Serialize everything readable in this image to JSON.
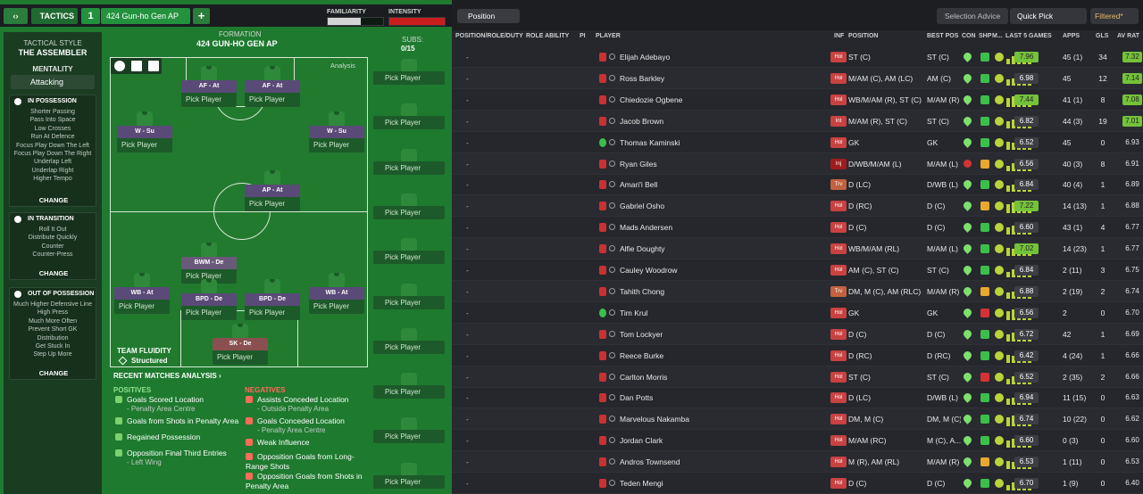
{
  "topbar": {
    "tactics_label": "TACTICS",
    "slot": "1",
    "tactic_name": "424 Gun-ho Gen AP",
    "add": "+",
    "familiarity_label": "FAMILIARITY",
    "intensity_label": "INTENSITY",
    "familiarity_level": 0.6,
    "intensity_level": 1.0
  },
  "sidebar": {
    "title": "TACTICAL STYLE",
    "style": "THE ASSEMBLER",
    "mentality_label": "MENTALITY",
    "mentality": "Attacking",
    "in_possession": {
      "title": "IN POSSESSION",
      "items": [
        "Shorter Passing",
        "Pass Into Space",
        "Low Crosses",
        "Run At Defence",
        "Focus Play Down The Left",
        "Focus Play Down The Right",
        "Underlap Left",
        "Underlap Right",
        "Higher Tempo"
      ],
      "change": "CHANGE"
    },
    "in_transition": {
      "title": "IN TRANSITION",
      "items": [
        "Roll It Out",
        "Distribute Quickly",
        "Counter",
        "Counter-Press"
      ],
      "change": "CHANGE"
    },
    "out_of_possession": {
      "title": "OUT OF POSSESSION",
      "items": [
        "Much Higher Defensive Line",
        "High Press",
        "Much More Often",
        "Prevent Short GK",
        "Distribution",
        "Get Stuck In",
        "Step Up More"
      ],
      "change": "CHANGE"
    }
  },
  "pitch": {
    "formation_label": "FORMATION",
    "formation": "424 GUN-HO GEN AP",
    "subs_label": "SUBS:",
    "subs_value": "0/15",
    "analysis": "Analysis",
    "pick_player": "Pick Player",
    "players": [
      {
        "role": "AF - At"
      },
      {
        "role": "AF - At"
      },
      {
        "role": "W - Su"
      },
      {
        "role": "W - Su"
      },
      {
        "role": "AP - At"
      },
      {
        "role": "BWM - De"
      },
      {
        "role": "WB - At"
      },
      {
        "role": "BPD - De"
      },
      {
        "role": "BPD - De"
      },
      {
        "role": "WB - At"
      },
      {
        "role": "SK - De"
      }
    ],
    "team_fluidity_label": "TEAM FLUIDITY",
    "team_fluidity": "Structured"
  },
  "recent": {
    "title": "RECENT MATCHES ANALYSIS ›",
    "positives_label": "POSITIVES",
    "negatives_label": "NEGATIVES",
    "positives": [
      {
        "text": "Goals Scored Location",
        "sub": "- Penalty Area Centre"
      },
      {
        "text": "Goals from Shots in Penalty Area",
        "sub": ""
      },
      {
        "text": "Regained Possession",
        "sub": ""
      },
      {
        "text": "Opposition Final Third Entries",
        "sub": "- Left Wing"
      }
    ],
    "negatives": [
      {
        "text": "Assists Conceded Location",
        "sub": "- Outside Penalty Area"
      },
      {
        "text": "Goals Conceded Location",
        "sub": "- Penalty Area Centre"
      },
      {
        "text": "Weak Influence",
        "sub": ""
      },
      {
        "text": "Opposition Goals from Long-Range Shots",
        "sub": ""
      },
      {
        "text": "Opposition Goals from Shots in Penalty Area",
        "sub": ""
      }
    ]
  },
  "right": {
    "position_dd": "Position",
    "selection_advice": "Selection Advice",
    "quick_pick": "Quick Pick",
    "filtered": "Filtered*",
    "headers": {
      "prd": "POSITION/ROLE/DUTY",
      "role_ability": "ROLE ABILITY",
      "pi": "PI",
      "player": "PLAYER",
      "inf": "INF",
      "position": "POSITION",
      "best_pos": "BEST POS",
      "con": "CON",
      "shp": "SHP",
      "m": "M...",
      "last5": "LAST 5 GAMES",
      "apps": "APPS",
      "gls": "GLS",
      "av_rat": "AV RAT"
    },
    "rows": [
      {
        "dash": "-",
        "name": "Elijah Adebayo",
        "inf": "Hol",
        "position": "ST (C)",
        "best": "ST (C)",
        "last5": "7.96",
        "last5_hi": true,
        "apps": "45 (1)",
        "gls": "34",
        "avr": "7.32",
        "avr_hi": true,
        "shirt": "outfield",
        "shp": "g",
        "con": "g"
      },
      {
        "dash": "-",
        "name": "Ross Barkley",
        "inf": "Hol",
        "position": "M/AM (C), AM (LC)",
        "best": "AM (C)",
        "last5": "6.98",
        "last5_hi": false,
        "apps": "45",
        "gls": "12",
        "avr": "7.14",
        "avr_hi": true,
        "shirt": "outfield",
        "shp": "g",
        "con": "g"
      },
      {
        "dash": "-",
        "name": "Chiedozie Ogbene",
        "inf": "Hol",
        "position": "WB/M/AM (R), ST (C)",
        "best": "M/AM (R)",
        "last5": "7.44",
        "last5_hi": true,
        "apps": "41 (1)",
        "gls": "8",
        "avr": "7.08",
        "avr_hi": true,
        "shirt": "outfield",
        "shp": "g",
        "con": "g"
      },
      {
        "dash": "-",
        "name": "Jacob Brown",
        "inf": "Int",
        "position": "M/AM (R), ST (C)",
        "best": "ST (C)",
        "last5": "6.82",
        "last5_hi": false,
        "apps": "44 (3)",
        "gls": "19",
        "avr": "7.01",
        "avr_hi": true,
        "shirt": "outfield",
        "shp": "g",
        "con": "g"
      },
      {
        "dash": "-",
        "name": "Thomas Kaminski",
        "inf": "Hol",
        "position": "GK",
        "best": "GK",
        "last5": "6.52",
        "last5_hi": false,
        "apps": "45",
        "gls": "0",
        "avr": "6.93",
        "avr_hi": false,
        "shirt": "gk",
        "shp": "g",
        "con": "g"
      },
      {
        "dash": "-",
        "name": "Ryan Giles",
        "inf": "Inj",
        "position": "D/WB/M/AM (L)",
        "best": "M/AM (L)",
        "last5": "6.56",
        "last5_hi": false,
        "apps": "40 (3)",
        "gls": "8",
        "avr": "6.91",
        "avr_hi": false,
        "shirt": "outfield",
        "shp": "y",
        "con": "r"
      },
      {
        "dash": "-",
        "name": "Amari'i Bell",
        "inf": "Trv",
        "position": "D (LC)",
        "best": "D/WB (L)",
        "last5": "6.84",
        "last5_hi": false,
        "apps": "40 (4)",
        "gls": "1",
        "avr": "6.89",
        "avr_hi": false,
        "shirt": "outfield",
        "shp": "g",
        "con": "g"
      },
      {
        "dash": "-",
        "name": "Gabriel Osho",
        "inf": "Hol",
        "position": "D (RC)",
        "best": "D (C)",
        "last5": "7.22",
        "last5_hi": true,
        "apps": "14 (13)",
        "gls": "1",
        "avr": "6.88",
        "avr_hi": false,
        "shirt": "outfield",
        "shp": "y",
        "con": "g"
      },
      {
        "dash": "-",
        "name": "Mads Andersen",
        "inf": "Hol",
        "position": "D (C)",
        "best": "D (C)",
        "last5": "6.60",
        "last5_hi": false,
        "apps": "43 (1)",
        "gls": "4",
        "avr": "6.77",
        "avr_hi": false,
        "shirt": "outfield",
        "shp": "g",
        "con": "g"
      },
      {
        "dash": "-",
        "name": "Alfie Doughty",
        "inf": "Hol",
        "position": "WB/M/AM (RL)",
        "best": "M/AM (L)",
        "last5": "7.02",
        "last5_hi": true,
        "apps": "14 (23)",
        "gls": "1",
        "avr": "6.77",
        "avr_hi": false,
        "shirt": "outfield",
        "shp": "g",
        "con": "g"
      },
      {
        "dash": "-",
        "name": "Cauley Woodrow",
        "inf": "Hol",
        "position": "AM (C), ST (C)",
        "best": "ST (C)",
        "last5": "6.84",
        "last5_hi": false,
        "apps": "2 (11)",
        "gls": "3",
        "avr": "6.75",
        "avr_hi": false,
        "shirt": "outfield",
        "shp": "g",
        "con": "g"
      },
      {
        "dash": "-",
        "name": "Tahith Chong",
        "inf": "Trv",
        "position": "DM, M (C), AM (RLC)",
        "best": "M/AM (R)",
        "last5": "6.88",
        "last5_hi": false,
        "apps": "2 (19)",
        "gls": "2",
        "avr": "6.74",
        "avr_hi": false,
        "shirt": "outfield",
        "shp": "y",
        "con": "g"
      },
      {
        "dash": "-",
        "name": "Tim Krul",
        "inf": "Hol",
        "position": "GK",
        "best": "GK",
        "last5": "6.56",
        "last5_hi": false,
        "apps": "2",
        "gls": "0",
        "avr": "6.70",
        "avr_hi": false,
        "shirt": "gk",
        "shp": "r",
        "con": "g"
      },
      {
        "dash": "-",
        "name": "Tom Lockyer",
        "inf": "Hol",
        "position": "D (C)",
        "best": "D (C)",
        "last5": "6.72",
        "last5_hi": false,
        "apps": "42",
        "gls": "1",
        "avr": "6.69",
        "avr_hi": false,
        "shirt": "outfield",
        "shp": "g",
        "con": "g"
      },
      {
        "dash": "-",
        "name": "Reece Burke",
        "inf": "Hol",
        "position": "D (RC)",
        "best": "D (RC)",
        "last5": "6.42",
        "last5_hi": false,
        "apps": "4 (24)",
        "gls": "1",
        "avr": "6.66",
        "avr_hi": false,
        "shirt": "outfield",
        "shp": "g",
        "con": "g"
      },
      {
        "dash": "-",
        "name": "Carlton Morris",
        "inf": "Hol",
        "position": "ST (C)",
        "best": "ST (C)",
        "last5": "6.52",
        "last5_hi": false,
        "apps": "2 (35)",
        "gls": "2",
        "avr": "6.66",
        "avr_hi": false,
        "shirt": "outfield",
        "shp": "r",
        "con": "g"
      },
      {
        "dash": "-",
        "name": "Dan Potts",
        "inf": "Hol",
        "position": "D (LC)",
        "best": "D/WB (L)",
        "last5": "6.94",
        "last5_hi": false,
        "apps": "11 (15)",
        "gls": "0",
        "avr": "6.63",
        "avr_hi": false,
        "shirt": "outfield",
        "shp": "g",
        "con": "g"
      },
      {
        "dash": "-",
        "name": "Marvelous Nakamba",
        "inf": "Hol",
        "position": "DM, M (C)",
        "best": "DM, M (C)",
        "last5": "6.74",
        "last5_hi": false,
        "apps": "10 (22)",
        "gls": "0",
        "avr": "6.62",
        "avr_hi": false,
        "shirt": "outfield",
        "shp": "g",
        "con": "g"
      },
      {
        "dash": "-",
        "name": "Jordan Clark",
        "inf": "Hol",
        "position": "M/AM (RC)",
        "best": "M (C), A...",
        "last5": "6.60",
        "last5_hi": false,
        "apps": "0 (3)",
        "gls": "0",
        "avr": "6.60",
        "avr_hi": false,
        "shirt": "outfield",
        "shp": "g",
        "con": "g"
      },
      {
        "dash": "-",
        "name": "Andros Townsend",
        "inf": "Hol",
        "position": "M (R), AM (RL)",
        "best": "M/AM (R)",
        "last5": "6.53",
        "last5_hi": false,
        "apps": "1 (11)",
        "gls": "0",
        "avr": "6.53",
        "avr_hi": false,
        "shirt": "outfield",
        "shp": "y",
        "con": "g"
      },
      {
        "dash": "-",
        "name": "Teden Mengi",
        "inf": "Hol",
        "position": "D (C)",
        "best": "D (C)",
        "last5": "6.70",
        "last5_hi": false,
        "apps": "1 (9)",
        "gls": "0",
        "avr": "6.40",
        "avr_hi": false,
        "shirt": "outfield",
        "shp": "g",
        "con": "g"
      }
    ]
  }
}
